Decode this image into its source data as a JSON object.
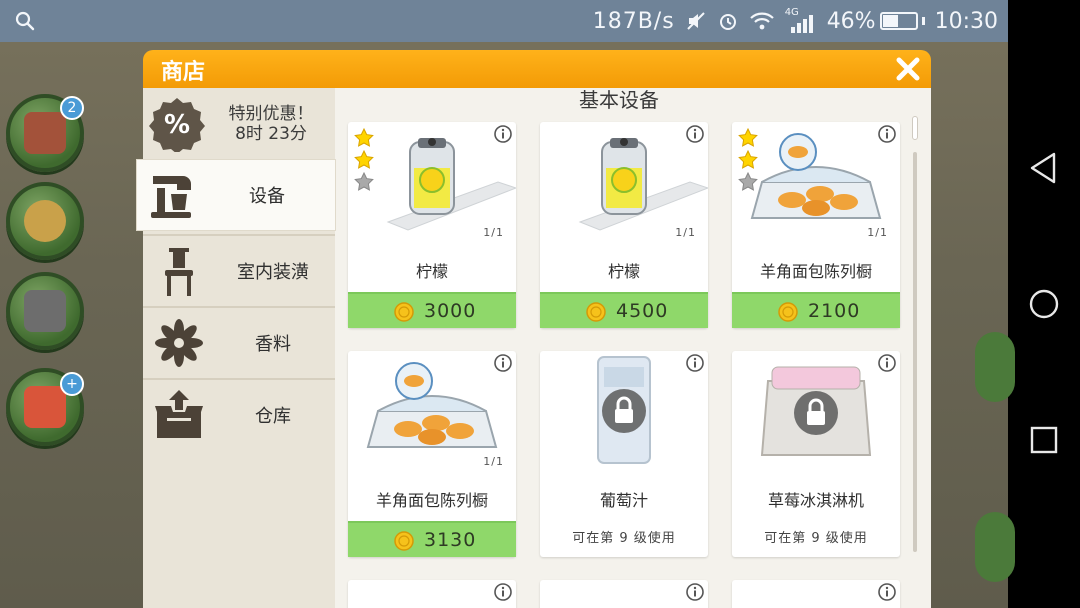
{
  "status_bar": {
    "net_speed": "187B/s",
    "network": "4G",
    "battery": "46%",
    "time": "10:30"
  },
  "shop": {
    "title": "商店",
    "promo": {
      "line1": "特别优惠！",
      "line2": "8时 23分"
    },
    "categories": [
      {
        "label": "设备",
        "icon": "mixer-icon",
        "active": true
      },
      {
        "label": "室内装潢",
        "icon": "chair-icon",
        "active": false
      },
      {
        "label": "香料",
        "icon": "star-anise-icon",
        "active": false
      },
      {
        "label": "仓库",
        "icon": "box-icon",
        "active": false
      }
    ],
    "section_title": "基本设备",
    "items": [
      {
        "name": "柠檬",
        "count": "1/1",
        "price": "3000",
        "stars": 2,
        "locked": false
      },
      {
        "name": "柠檬",
        "count": "1/1",
        "price": "4500",
        "stars": 0,
        "locked": false
      },
      {
        "name": "羊角面包陈列橱",
        "count": "1/1",
        "price": "2100",
        "stars": 2,
        "locked": false
      },
      {
        "name": "羊角面包陈列橱",
        "count": "1/1",
        "price": "3130",
        "stars": 0,
        "locked": false
      },
      {
        "name": "葡萄汁",
        "requirement": "可在第 9 级使用",
        "locked": true
      },
      {
        "name": "草莓冰淇淋机",
        "requirement": "可在第 9 级使用",
        "locked": true
      }
    ]
  },
  "colors": {
    "header_orange": "#f39b06",
    "price_green": "#8fd86a",
    "star_gold": "#ffd400",
    "status_bar": "#6f8398"
  }
}
